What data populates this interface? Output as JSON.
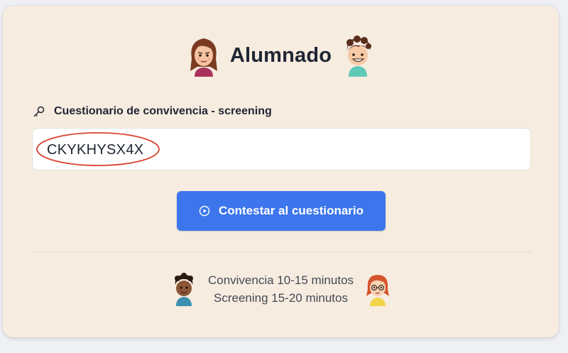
{
  "header": {
    "title": "Alumnado",
    "left_avatar_icon": "girl-avatar-icon",
    "right_avatar_icon": "boy-avatar-icon"
  },
  "form": {
    "key_icon": "key-icon",
    "label": "Cuestionario de convivencia - screening",
    "code_value": "CKYKHYSX4X"
  },
  "submit": {
    "icon": "play-circle-icon",
    "label": "Contestar al cuestionario",
    "color": "#3d76ec"
  },
  "footer": {
    "line1": "Convivencia 10-15 minutos",
    "line2": "Screening 15-20 minutos",
    "left_avatar_icon": "boy-dark-avatar-icon",
    "right_avatar_icon": "redhead-glasses-avatar-icon"
  },
  "colors": {
    "card_background": "#f7ece0",
    "annotation_circle": "#d9412f"
  }
}
